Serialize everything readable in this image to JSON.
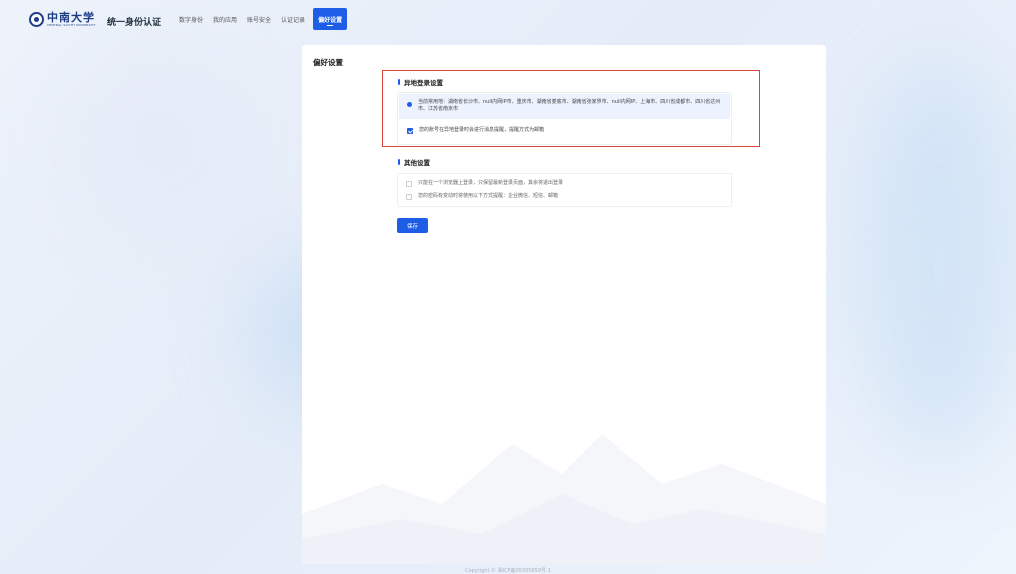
{
  "header": {
    "logo_name": "中南大学",
    "logo_sub": "CENTRAL SOUTH UNIVERSITY",
    "app_title": "统一身份认证",
    "nav": [
      {
        "label": "数字身份",
        "active": false
      },
      {
        "label": "我的应用",
        "active": false
      },
      {
        "label": "账号安全",
        "active": false
      },
      {
        "label": "认证记录",
        "active": false
      },
      {
        "label": "偏好设置",
        "active": true
      }
    ]
  },
  "page": {
    "title": "偏好设置",
    "remote_login": {
      "section_title": "异地登录设置",
      "usual_locations": "当前常用地：湖南省长沙市、null内网IP市、重庆市、湖南省娄底市、湖南省张家界市、null内网IP、上海市、四川省成都市、四川省达州市、江苏省南京市",
      "notify_option": "您的账号在异地登录时会进行消息提醒，提醒方式为邮箱",
      "notify_checked": true
    },
    "other": {
      "section_title": "其他设置",
      "single_browser_option": "只能在一个浏览器上登录，只保留最新登录页面，其余将退出登录",
      "single_browser_checked": false,
      "password_change_option": "您的密码有变动时将使用以下方式提醒：企业微信、短信、邮箱",
      "password_change_checked": false
    },
    "save_label": "保存"
  },
  "footer": {
    "copyright": "Copyright © 湘ICP备05005659号-1"
  },
  "colors": {
    "accent": "#1e5ee6",
    "highlight_border": "#d9463c",
    "brand": "#1c3c86"
  }
}
